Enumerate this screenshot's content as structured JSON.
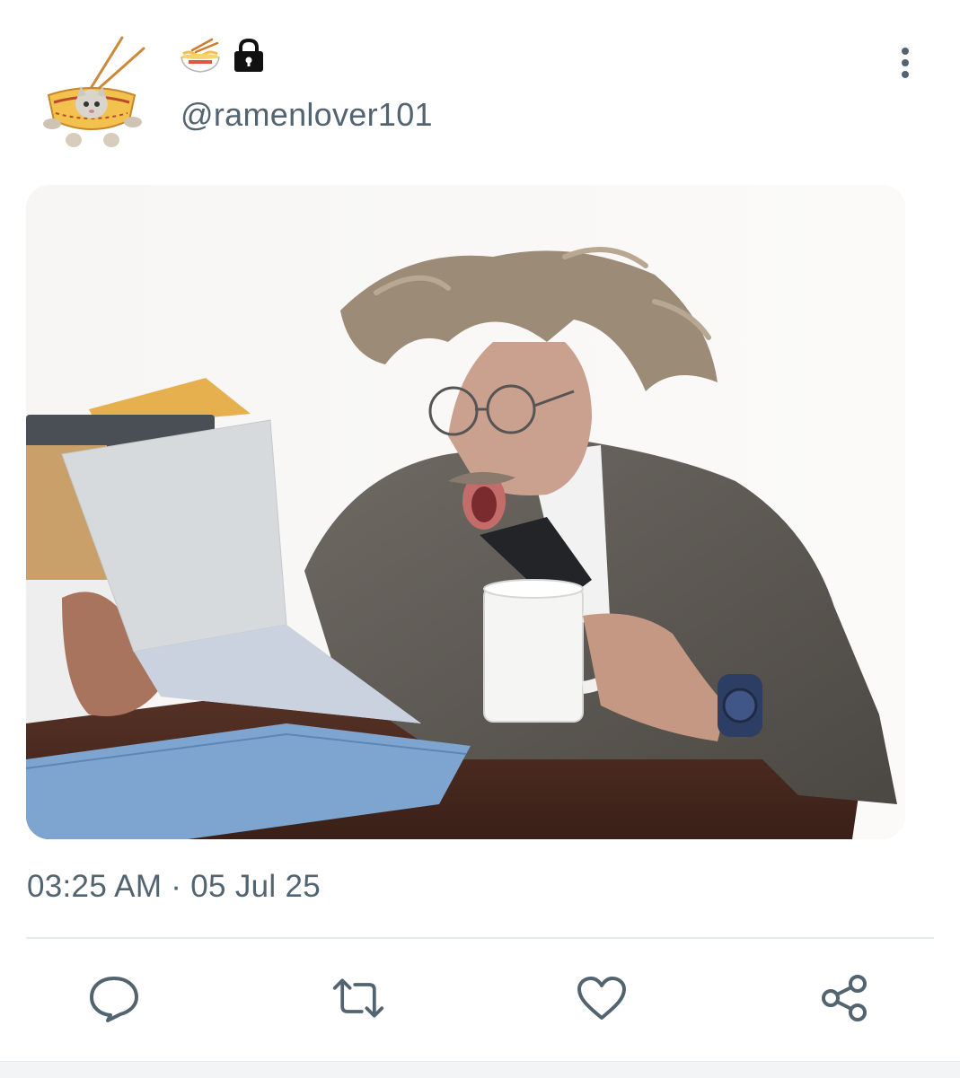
{
  "post": {
    "author": {
      "handle": "@ramenlover101",
      "name_icons": [
        "ramen-bowl-icon",
        "lock-icon"
      ]
    },
    "timestamp": "03:25 AM · 05 Jul 25",
    "actions": [
      "reply-icon",
      "retweet-icon",
      "like-icon",
      "share-icon"
    ],
    "menu_icon": "more-vertical-icon"
  },
  "colors": {
    "text_secondary": "#536471",
    "divider": "#e6e9eb",
    "background": "#ffffff"
  }
}
